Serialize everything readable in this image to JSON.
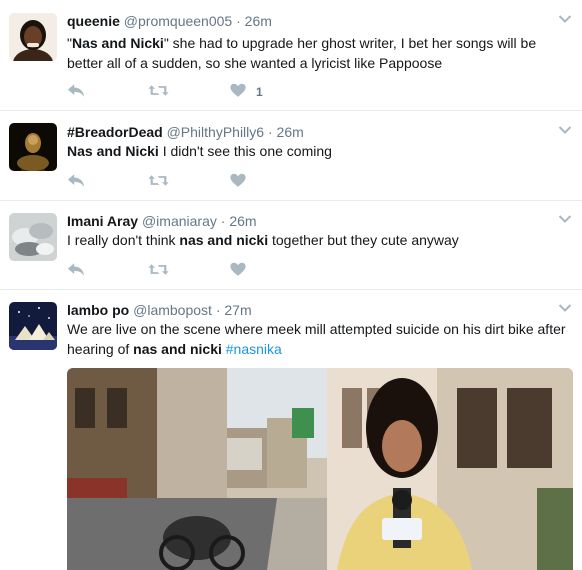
{
  "tweets": [
    {
      "name": "queenie",
      "handle": "@promqueen005",
      "time": "26m",
      "text_parts": [
        "\"",
        "Nas and Nicki",
        "\" she had to upgrade her ghost writer, I bet her songs will be better all of a sudden, so she wanted a lyricist like Pappoose"
      ],
      "like_count": "1"
    },
    {
      "name": "#BreadorDead",
      "handle": "@PhilthyPhilly6",
      "time": "26m",
      "text_parts": [
        "Nas and Nicki",
        " I didn't see this one coming"
      ]
    },
    {
      "name": "Imani Aray",
      "handle": "@imaniaray",
      "time": "26m",
      "text_parts": [
        "I really don't think ",
        "nas and nicki",
        " together but they cute anyway"
      ]
    },
    {
      "name": "lambo po",
      "handle": "@lambopost",
      "time": "27m",
      "text_parts": [
        "We are live on the scene  where meek mill attempted suicide on his dirt bike after hearing of ",
        "nas and nicki",
        " ",
        "#nasnika"
      ]
    }
  ],
  "separator": "·",
  "icons": {
    "reply": "reply-icon",
    "retweet": "retweet-icon",
    "like": "heart-icon",
    "menu": "chevron-down-icon"
  },
  "colors": {
    "text": "#14171a",
    "muted": "#657786",
    "icon": "#aab8c2",
    "link": "#1b95e0",
    "border": "#e6ecf0"
  }
}
